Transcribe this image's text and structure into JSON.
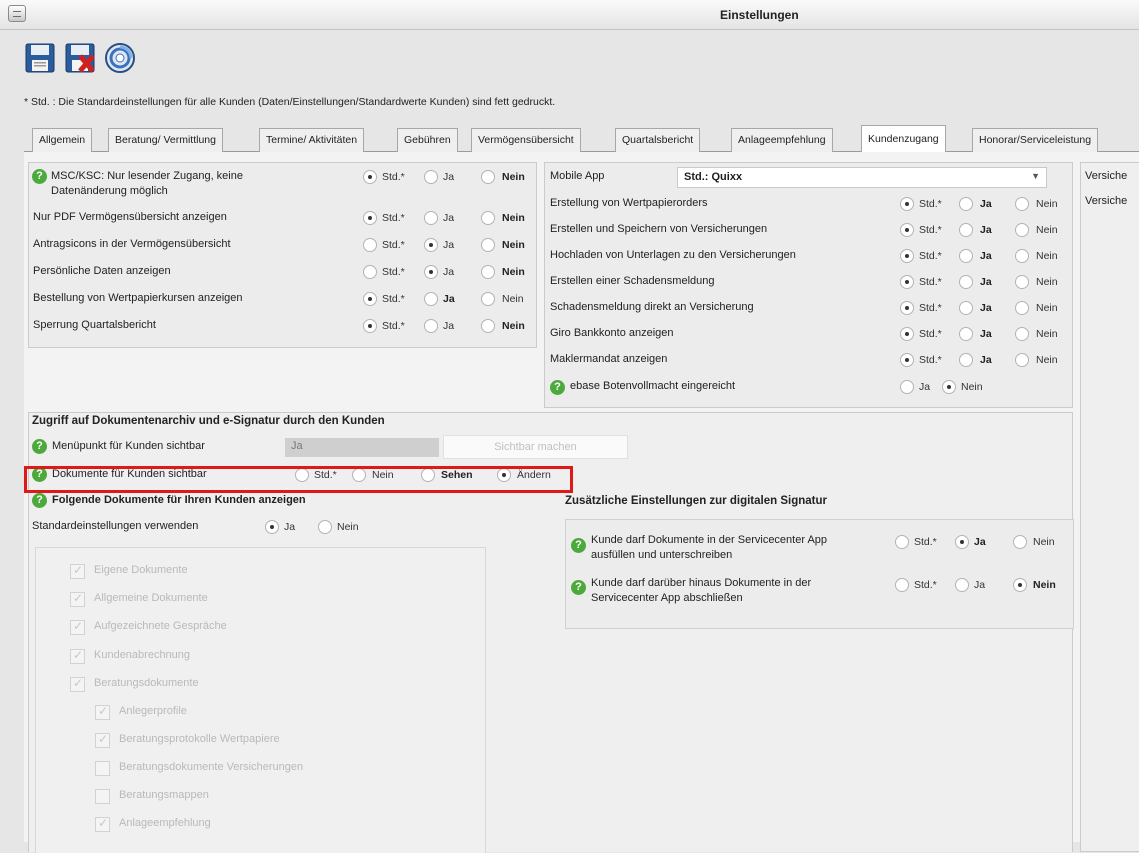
{
  "window": {
    "title": "Einstellungen"
  },
  "note": "* Std. : Die Standardeinstellungen für alle Kunden (Daten/Einstellungen/Standardwerte Kunden) sind fett gedruckt.",
  "tabs": [
    {
      "label": "Allgemein",
      "active": false
    },
    {
      "label": "Beratung/ Vermittlung",
      "active": false
    },
    {
      "label": "Termine/ Aktivitäten",
      "active": false
    },
    {
      "label": "Gebühren",
      "active": false
    },
    {
      "label": "Vermögensübersicht",
      "active": false
    },
    {
      "label": "Quartalsbericht",
      "active": false
    },
    {
      "label": "Anlageempfehlung",
      "active": false
    },
    {
      "label": "Kundenzugang",
      "active": true
    },
    {
      "label": "Honorar/Serviceleistung",
      "active": false
    }
  ],
  "options": {
    "std": "Std.*",
    "ja": "Ja",
    "nein": "Nein",
    "sehen": "Sehen",
    "aendern": "Ändern"
  },
  "left_panel": {
    "rows": [
      {
        "label": "MSC/KSC: Nur lesender Zugang, keine Datenänderung möglich",
        "selected": "std"
      },
      {
        "label": "Nur PDF Vermögensübersicht anzeigen",
        "selected": "std"
      },
      {
        "label": "Antragsicons in der Vermögensübersicht",
        "selected": "ja"
      },
      {
        "label": "Persönliche Daten anzeigen",
        "selected": "ja"
      },
      {
        "label": "Bestellung von Wertpapierkursen anzeigen",
        "selected": "std"
      },
      {
        "label": "Sperrung Quartalsbericht",
        "selected": "std"
      }
    ]
  },
  "right_panel": {
    "mobile_app_label": "Mobile App",
    "mobile_app_value": "Std.: Quixx",
    "rows": [
      {
        "label": "Erstellung von Wertpapierorders",
        "selected": "std"
      },
      {
        "label": "Erstellen und Speichern von Versicherungen",
        "selected": "std"
      },
      {
        "label": "Hochladen von Unterlagen zu den Versicherungen",
        "selected": "std"
      },
      {
        "label": "Erstellen einer Schadensmeldung",
        "selected": "std"
      },
      {
        "label": "Schadensmeldung direkt an Versicherung",
        "selected": "std"
      },
      {
        "label": "Giro Bankkonto anzeigen",
        "selected": "std"
      },
      {
        "label": "Maklermandat anzeigen",
        "selected": "std"
      }
    ],
    "ebase_label": "ebase Botenvollmacht eingereicht",
    "ebase_selected": "nein"
  },
  "far_right": {
    "items": [
      "Versiche",
      "Versiche"
    ]
  },
  "doc_section": {
    "title": "Zugriff auf Dokumentenarchiv und e-Signatur durch den Kunden",
    "menu_label": "Menüpunkt für Kunden sichtbar",
    "menu_value": "Ja",
    "make_visible_button": "Sichtbar machen",
    "docs_label": "Dokumente für Kunden sichtbar",
    "docs_selected": "aendern",
    "following_label": "Folgende Dokumente für Ihren Kunden anzeigen",
    "standard_label": "Standardeinstellungen verwenden",
    "standard_selected": "ja",
    "documents": [
      {
        "label": "Eigene Dokumente",
        "checked": true,
        "indent": 0
      },
      {
        "label": "Allgemeine Dokumente",
        "checked": true,
        "indent": 0
      },
      {
        "label": "Aufgezeichnete Gespräche",
        "checked": true,
        "indent": 0
      },
      {
        "label": "Kundenabrechnung",
        "checked": true,
        "indent": 0
      },
      {
        "label": "Beratungsdokumente",
        "checked": true,
        "indent": 0
      },
      {
        "label": "Anlegerprofile",
        "checked": true,
        "indent": 1
      },
      {
        "label": "Beratungsprotokolle Wertpapiere",
        "checked": true,
        "indent": 1
      },
      {
        "label": "Beratungsdokumente Versicherungen",
        "checked": false,
        "indent": 1
      },
      {
        "label": "Beratungsmappen",
        "checked": false,
        "indent": 1
      },
      {
        "label": "Anlageempfehlung",
        "checked": true,
        "indent": 1
      }
    ]
  },
  "signature_section": {
    "title": "Zusätzliche Einstellungen zur digitalen Signatur",
    "rows": [
      {
        "label1": "Kunde darf Dokumente in der Servicecenter App",
        "label2": "ausfüllen und unterschreiben",
        "selected": "ja"
      },
      {
        "label1": "Kunde darf darüber hinaus Dokumente in der",
        "label2": "Servicecenter App abschließen",
        "selected": "nein"
      }
    ]
  },
  "colors": {
    "highlight": "#e01818",
    "help": "#4caa3c"
  }
}
